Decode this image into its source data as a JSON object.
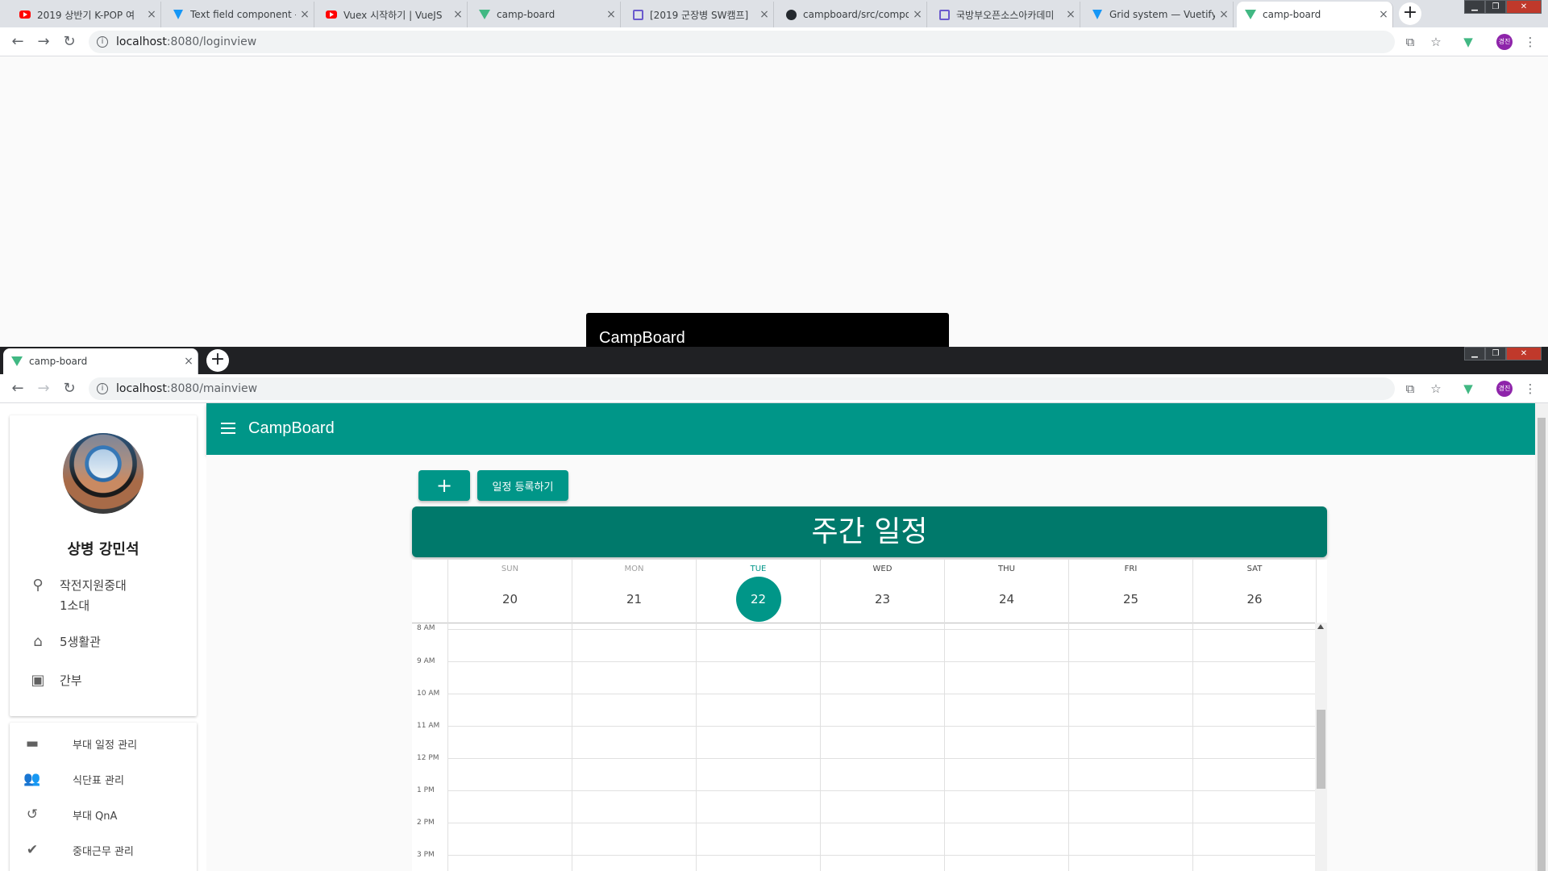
{
  "back_window": {
    "tabs": [
      {
        "title": "2019 상반기 K-POP 여",
        "icon": "youtube-icon"
      },
      {
        "title": "Text field component -",
        "icon": "vuetify-icon"
      },
      {
        "title": "Vuex 시작하기 | VueJS",
        "icon": "youtube-icon"
      },
      {
        "title": "camp-board",
        "icon": "vue-icon"
      },
      {
        "title": "[2019 군장병 SW캠프]",
        "icon": "bookmark-icon"
      },
      {
        "title": "campboard/src/compo",
        "icon": "github-icon"
      },
      {
        "title": "국방부오픈소스아카데미",
        "icon": "bookmark-icon"
      },
      {
        "title": "Grid system — Vuetify",
        "icon": "vuetify-icon"
      },
      {
        "title": "camp-board",
        "icon": "vue-icon"
      }
    ],
    "url_host": "localhost",
    "url_path": ":8080/loginview",
    "tooltip": "CampBoard"
  },
  "front_window": {
    "tab_title": "camp-board",
    "url_host": "localhost",
    "url_path": ":8080/mainview",
    "profile_initial": "경진"
  },
  "app": {
    "title": "CampBoard",
    "profile": {
      "name": "상병 강민석",
      "unit_line1": "작전지원중대",
      "unit_line2": "1소대",
      "barracks": "5생활관",
      "role": "간부"
    },
    "menu": [
      {
        "label": "부대 일정 관리",
        "icon": "folder-icon"
      },
      {
        "label": "식단표 관리",
        "icon": "people-icon"
      },
      {
        "label": "부대 QnA",
        "icon": "history-icon"
      },
      {
        "label": "중대근무 관리",
        "icon": "check-circle-icon"
      }
    ],
    "add_button": "+",
    "register_button": "일정 등록하기",
    "calendar": {
      "title": "주간 일정",
      "days": [
        {
          "wd": "SUN",
          "num": "20"
        },
        {
          "wd": "MON",
          "num": "21"
        },
        {
          "wd": "TUE",
          "num": "22"
        },
        {
          "wd": "WED",
          "num": "23"
        },
        {
          "wd": "THU",
          "num": "24"
        },
        {
          "wd": "FRI",
          "num": "25"
        },
        {
          "wd": "SAT",
          "num": "26"
        }
      ],
      "today": "22",
      "hours": [
        "8 AM",
        "9 AM",
        "10 AM",
        "11 AM",
        "12 PM",
        "1 PM",
        "2 PM",
        "3 PM"
      ]
    },
    "accent": "#009688",
    "header_color": "#00796b"
  }
}
